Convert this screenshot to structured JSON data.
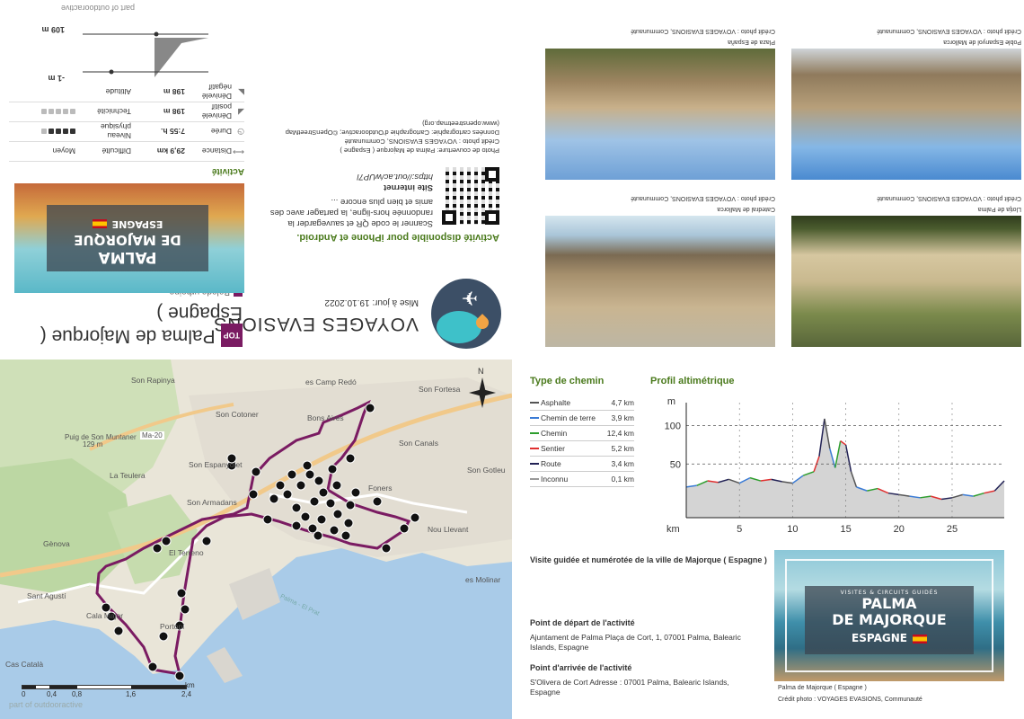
{
  "header": {
    "agency_name": "VOYAGES EVASIONS",
    "update_label": "Mise à jour: 19.10.2022",
    "top_badge": "TOP",
    "title": "Palma de Majorque ( Espagne )",
    "category": "Balade urbaine",
    "cover_line1": "PALMA",
    "cover_line2": "DE MAJORQUE",
    "cover_line3": "ESPAGNE"
  },
  "app": {
    "available_text": "Activité disponible pour iPhone et Android.",
    "qr_description": "Scanner le code QR et sauvegarder la randonnée hors-ligne, la partager avec des amis et bien plus encore ...",
    "website_label": "Site internet",
    "website_url": "https://out.ac/wUP7l",
    "credit_cover": "Photo de couverture: Palma de Majorque ( Espagne )",
    "credit_photo": "Crédit photo : VOYAGES EVASIONS, Communauté",
    "credit_map": "Données cartographie: Cartographie d'Outdooractive; ©OpenStreetMap (www.openstreetmap.org)"
  },
  "activity": {
    "heading": "Activité",
    "rows": [
      {
        "label": "Distance",
        "value": "29,9 km",
        "label2": "Difficulté",
        "value2": "Moyen"
      },
      {
        "label": "Durée",
        "value": "7:55 h.",
        "label2": "Niveau physique",
        "dots": 5,
        "on": 4
      },
      {
        "label": "Dénivelé positif",
        "value": "198 m",
        "label2": "Technicité",
        "dots": 5,
        "on": 0
      },
      {
        "label": "Dénivelé négatif",
        "value": "198 m",
        "label2": "Altitude",
        "value2": ""
      }
    ],
    "alt_max": "109 m",
    "alt_min": "-1 m",
    "part_of": "part of outdooractive"
  },
  "photos": [
    {
      "title": "Plaza de España",
      "credit": "Crédit photo : VOYAGES EVASIONS, Communauté"
    },
    {
      "title": "Poble Espanyol de Mallorca",
      "credit": "Crédit photo : VOYAGES EVASIONS, Communauté"
    },
    {
      "title": "Catedral de Mallorca",
      "credit": "Crédit photo : VOYAGES EVASIONS, Communauté"
    },
    {
      "title": "Llotja de Palma",
      "credit": "Crédit photo : VOYAGES EVASIONS, Communauté"
    }
  ],
  "map": {
    "labels": [
      "Son Rapinya",
      "Puig de Son Muntaner",
      "129 m",
      "Ma-20",
      "Son Cotoner",
      "Son Espanyolet",
      "La Teulera",
      "Son Armadans",
      "El Terreno",
      "Gènova",
      "Portopí",
      "Sant Agustí",
      "Cala Major",
      "Cas Català",
      "es Camp Redó",
      "Bons Aires",
      "Son Fortesa",
      "Son Canals",
      "Son Gotleu",
      "Foners",
      "Nou Llevant",
      "es Molinar",
      "Palma - El Prat"
    ],
    "scale": [
      "0",
      "0,4",
      "0,8",
      "1,6",
      "2,4",
      "km"
    ],
    "compass": "N",
    "watermark": "part of outdooractive"
  },
  "surface": {
    "heading": "Type de chemin",
    "rows": [
      {
        "name": "Asphalte",
        "value": "4,7 km",
        "color": "#555555"
      },
      {
        "name": "Chemin de terre",
        "value": "3,9 km",
        "color": "#3a7bd5"
      },
      {
        "name": "Chemin",
        "value": "12,4 km",
        "color": "#2e9e2e"
      },
      {
        "name": "Sentier",
        "value": "5,2 km",
        "color": "#e03030"
      },
      {
        "name": "Route",
        "value": "3,4 km",
        "color": "#222255"
      },
      {
        "name": "Inconnu",
        "value": "0,1 km",
        "color": "#999999"
      }
    ]
  },
  "chart_data": {
    "type": "area",
    "title": "Profil altimétrique",
    "ylabel": "m",
    "xlabel": "km",
    "xlim": [
      0,
      29.9
    ],
    "ylim": [
      -20,
      130
    ],
    "yticks": [
      50,
      100
    ],
    "xticks": [
      5,
      10,
      15,
      20,
      25
    ],
    "x": [
      0,
      1,
      2,
      3,
      4,
      5,
      6,
      7,
      8,
      9,
      10,
      11,
      12,
      12.5,
      13,
      13.5,
      14,
      14.5,
      15,
      15.5,
      16,
      17,
      18,
      19,
      20,
      21,
      22,
      23,
      24,
      25,
      26,
      27,
      28,
      29,
      29.9
    ],
    "y": [
      20,
      22,
      28,
      26,
      30,
      25,
      32,
      28,
      30,
      27,
      25,
      35,
      40,
      60,
      109,
      70,
      45,
      80,
      75,
      40,
      20,
      15,
      18,
      12,
      10,
      8,
      6,
      8,
      4,
      6,
      10,
      8,
      12,
      15,
      28
    ]
  },
  "details": {
    "visit_title": "Visite guidée et numérotée de la ville de Majorque ( Espagne )",
    "start_heading": "Point de départ de l'activité",
    "start_text": "Ajuntament de Palma Plaça de Cort, 1, 07001 Palma, Balearic Islands, Espagne",
    "end_heading": "Point d'arrivée de l'activité",
    "end_text": "S'Olivera de Cort  Adresse : 07001 Palma, Balearic Islands, Espagne",
    "cover_small": "Palma de Majorque ( Espagne )",
    "cover_credit": "Crédit photo : VOYAGES EVASIONS, Communauté",
    "cover_tag": "VISITES & CIRCUITS GUIDÉS",
    "cover_line1": "PALMA",
    "cover_line2": "DE MAJORQUE",
    "cover_line3": "ESPAGNE"
  }
}
